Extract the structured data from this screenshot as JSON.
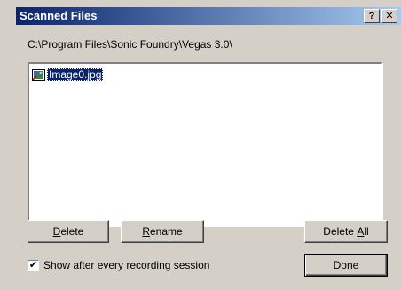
{
  "window": {
    "title": "Scanned Files",
    "help_label": "?",
    "close_label": "✕"
  },
  "path": "C:\\Program Files\\Sonic Foundry\\Vegas 3.0\\",
  "files": [
    {
      "name": "Image0.jpg",
      "icon": "image-file-icon",
      "selected": true
    }
  ],
  "buttons": {
    "delete": {
      "pre": "",
      "mnemonic": "D",
      "post": "elete"
    },
    "rename": {
      "pre": "",
      "mnemonic": "R",
      "post": "ename"
    },
    "delete_all": {
      "pre": "Delete ",
      "mnemonic": "A",
      "post": "ll"
    },
    "done": {
      "pre": "Do",
      "mnemonic": "n",
      "post": "e"
    }
  },
  "show_after_session": {
    "checked": true,
    "check_mark": "✔",
    "pre": "",
    "mnemonic": "S",
    "post": "how after every recording session"
  },
  "colors": {
    "titlebar_start": "#0a246a",
    "titlebar_end": "#a6caf0",
    "dialog_face": "#d4d0c8",
    "selection": "#0a246a"
  }
}
